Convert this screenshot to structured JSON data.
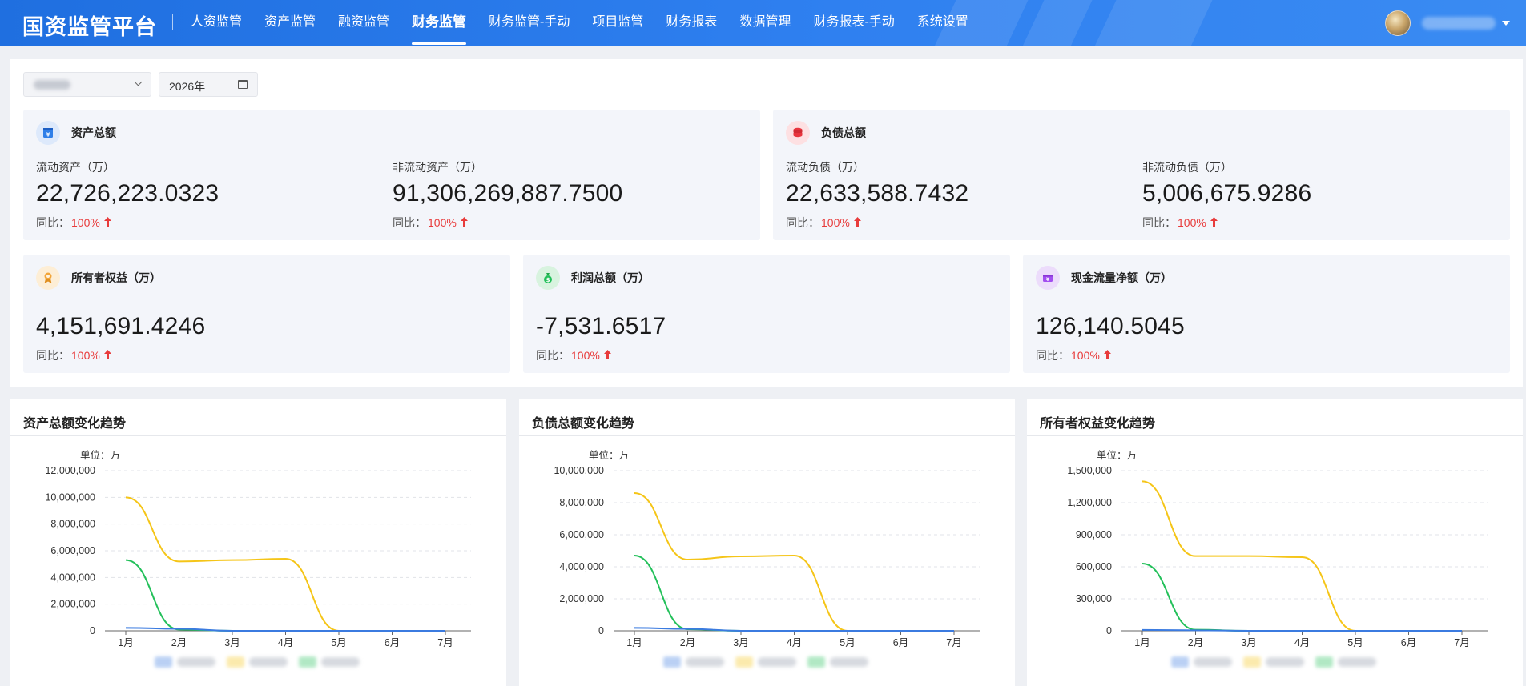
{
  "app": {
    "title": "国资监管平台"
  },
  "nav": [
    {
      "label": "人资监管",
      "active": false
    },
    {
      "label": "资产监管",
      "active": false
    },
    {
      "label": "融资监管",
      "active": false
    },
    {
      "label": "财务监管",
      "active": true
    },
    {
      "label": "财务监管-手动",
      "active": false
    },
    {
      "label": "项目监管",
      "active": false
    },
    {
      "label": "财务报表",
      "active": false
    },
    {
      "label": "数据管理",
      "active": false
    },
    {
      "label": "财务报表-手动",
      "active": false
    },
    {
      "label": "系统设置",
      "active": false
    }
  ],
  "filters": {
    "year": "2026年"
  },
  "cards": {
    "assets": {
      "title": "资产总额",
      "metrics": [
        {
          "label": "流动资产（万）",
          "value": "22,726,223.0323",
          "yoy_label": "同比：",
          "yoy": "100%"
        },
        {
          "label": "非流动资产（万）",
          "value": "91,306,269,887.7500",
          "yoy_label": "同比：",
          "yoy": "100%"
        }
      ]
    },
    "liabilities": {
      "title": "负债总额",
      "metrics": [
        {
          "label": "流动负债（万）",
          "value": "22,633,588.7432",
          "yoy_label": "同比：",
          "yoy": "100%"
        },
        {
          "label": "非流动负债（万）",
          "value": "5,006,675.9286",
          "yoy_label": "同比：",
          "yoy": "100%"
        }
      ]
    },
    "equity": {
      "title": "所有者权益（万）",
      "value": "4,151,691.4246",
      "yoy_label": "同比：",
      "yoy": "100%"
    },
    "profit": {
      "title": "利润总额（万）",
      "value": "-7,531.6517",
      "yoy_label": "同比：",
      "yoy": "100%"
    },
    "cashflow": {
      "title": "现金流量净额（万）",
      "value": "126,140.5045",
      "yoy_label": "同比：",
      "yoy": "100%"
    }
  },
  "colors": {
    "header": "#2f80f0",
    "up": "#e83b3b",
    "series_blue": "#3b7be0",
    "series_yellow": "#f5c518",
    "series_green": "#23c05a"
  },
  "chart_data": [
    {
      "type": "line",
      "title": "资产总额变化趋势",
      "ylabel": "单位：万",
      "categories": [
        "1月",
        "2月",
        "3月",
        "4月",
        "5月",
        "6月",
        "7月"
      ],
      "ylim": [
        0,
        12000000
      ],
      "yticks": [
        0,
        2000000,
        4000000,
        6000000,
        8000000,
        10000000,
        12000000
      ],
      "grid": true,
      "series": [
        {
          "color": "#f5c518",
          "values": [
            10000000,
            5200000,
            5300000,
            5400000,
            0,
            0,
            0
          ]
        },
        {
          "color": "#23c05a",
          "values": [
            5300000,
            100000,
            0,
            0,
            0,
            0,
            0
          ]
        },
        {
          "color": "#3b7be0",
          "values": [
            220000,
            150000,
            0,
            0,
            0,
            0,
            0
          ]
        }
      ]
    },
    {
      "type": "line",
      "title": "负债总额变化趋势",
      "ylabel": "单位：万",
      "categories": [
        "1月",
        "2月",
        "3月",
        "4月",
        "5月",
        "6月",
        "7月"
      ],
      "ylim": [
        0,
        10000000
      ],
      "yticks": [
        0,
        2000000,
        4000000,
        6000000,
        8000000,
        10000000
      ],
      "grid": true,
      "series": [
        {
          "color": "#f5c518",
          "values": [
            8600000,
            4450000,
            4650000,
            4700000,
            0,
            0,
            0
          ]
        },
        {
          "color": "#23c05a",
          "values": [
            4700000,
            100000,
            0,
            0,
            0,
            0,
            0
          ]
        },
        {
          "color": "#3b7be0",
          "values": [
            180000,
            120000,
            0,
            0,
            0,
            0,
            0
          ]
        }
      ]
    },
    {
      "type": "line",
      "title": "所有者权益变化趋势",
      "ylabel": "单位：万",
      "categories": [
        "1月",
        "2月",
        "3月",
        "4月",
        "5月",
        "6月",
        "7月"
      ],
      "ylim": [
        0,
        1500000
      ],
      "yticks": [
        0,
        300000,
        600000,
        900000,
        1200000,
        1500000
      ],
      "grid": true,
      "series": [
        {
          "color": "#f5c518",
          "values": [
            1400000,
            700000,
            700000,
            690000,
            0,
            0,
            0
          ]
        },
        {
          "color": "#23c05a",
          "values": [
            630000,
            10000,
            0,
            0,
            0,
            0,
            0
          ]
        },
        {
          "color": "#3b7be0",
          "values": [
            8000,
            5000,
            0,
            0,
            0,
            0,
            0
          ]
        }
      ]
    }
  ]
}
